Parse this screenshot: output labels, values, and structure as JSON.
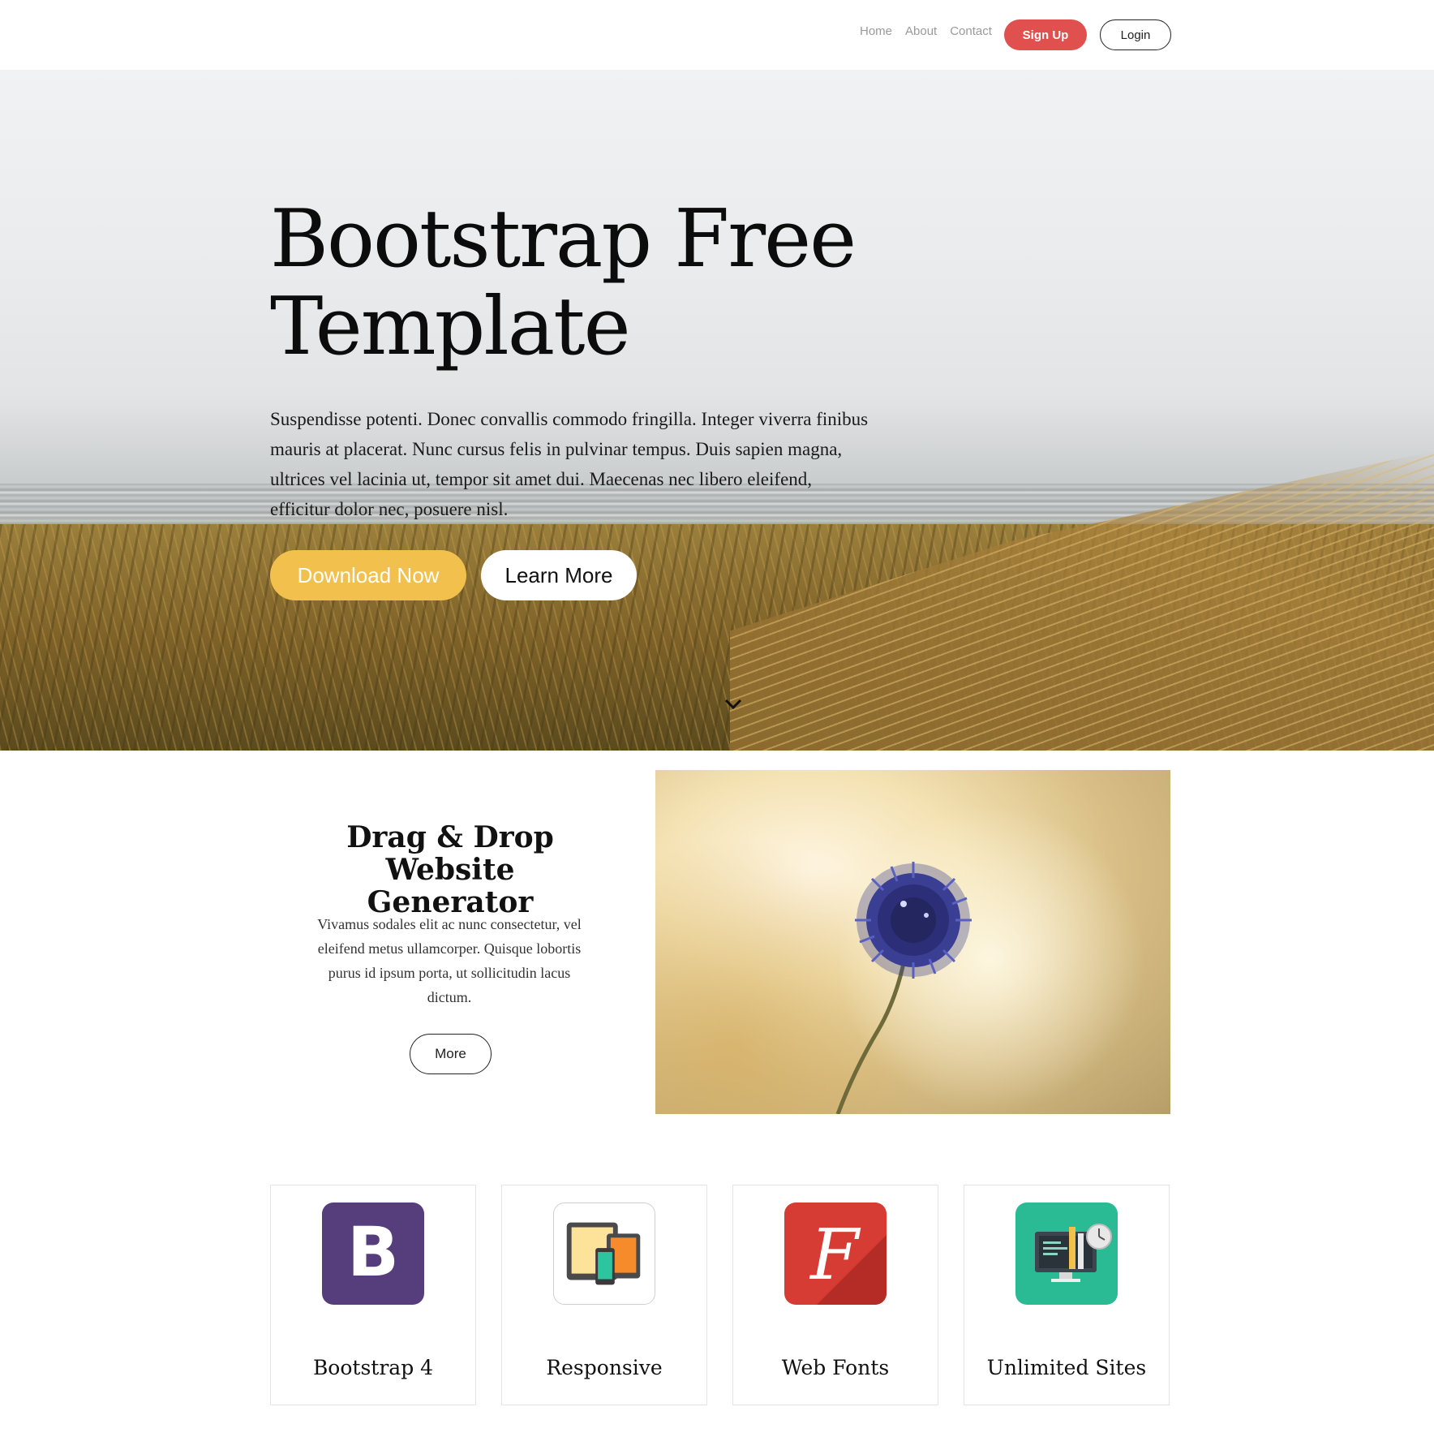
{
  "nav": {
    "links": [
      "Home",
      "About",
      "Contact"
    ],
    "signup_label": "Sign Up",
    "login_label": "Login"
  },
  "hero": {
    "title": "Bootstrap Free Template",
    "text": "Suspendisse potenti. Donec convallis commodo fringilla. Integer viverra finibus mauris at placerat. Nunc cursus felis in pulvinar tempus. Duis sapien magna, ultrices vel lacinia ut, tempor sit amet dui. Maecenas nec libero eleifend, efficitur dolor nec, posuere nisl.",
    "download_label": "Download Now",
    "learn_label": "Learn More",
    "scroll_icon": "chevron-down-icon"
  },
  "feature": {
    "title": "Drag & Drop Website Generator",
    "text": "Vivamus sodales elit ac nunc consectetur, vel eleifend metus ullamcorper. Quisque lobortis purus id ipsum porta, ut sollicitudin lacus dictum.",
    "more_label": "More"
  },
  "cards": [
    {
      "label": "Bootstrap 4",
      "icon": "bootstrap-icon",
      "color": "#563d7c"
    },
    {
      "label": "Responsive",
      "icon": "responsive-devices-icon",
      "color": "#ffffff"
    },
    {
      "label": "Web Fonts",
      "icon": "web-fonts-icon",
      "color": "#d63b34"
    },
    {
      "label": "Unlimited Sites",
      "icon": "unlimited-sites-icon",
      "color": "#2bbb94"
    }
  ],
  "colors": {
    "accent_red": "#e0504e",
    "accent_yellow": "#f1c04d"
  }
}
